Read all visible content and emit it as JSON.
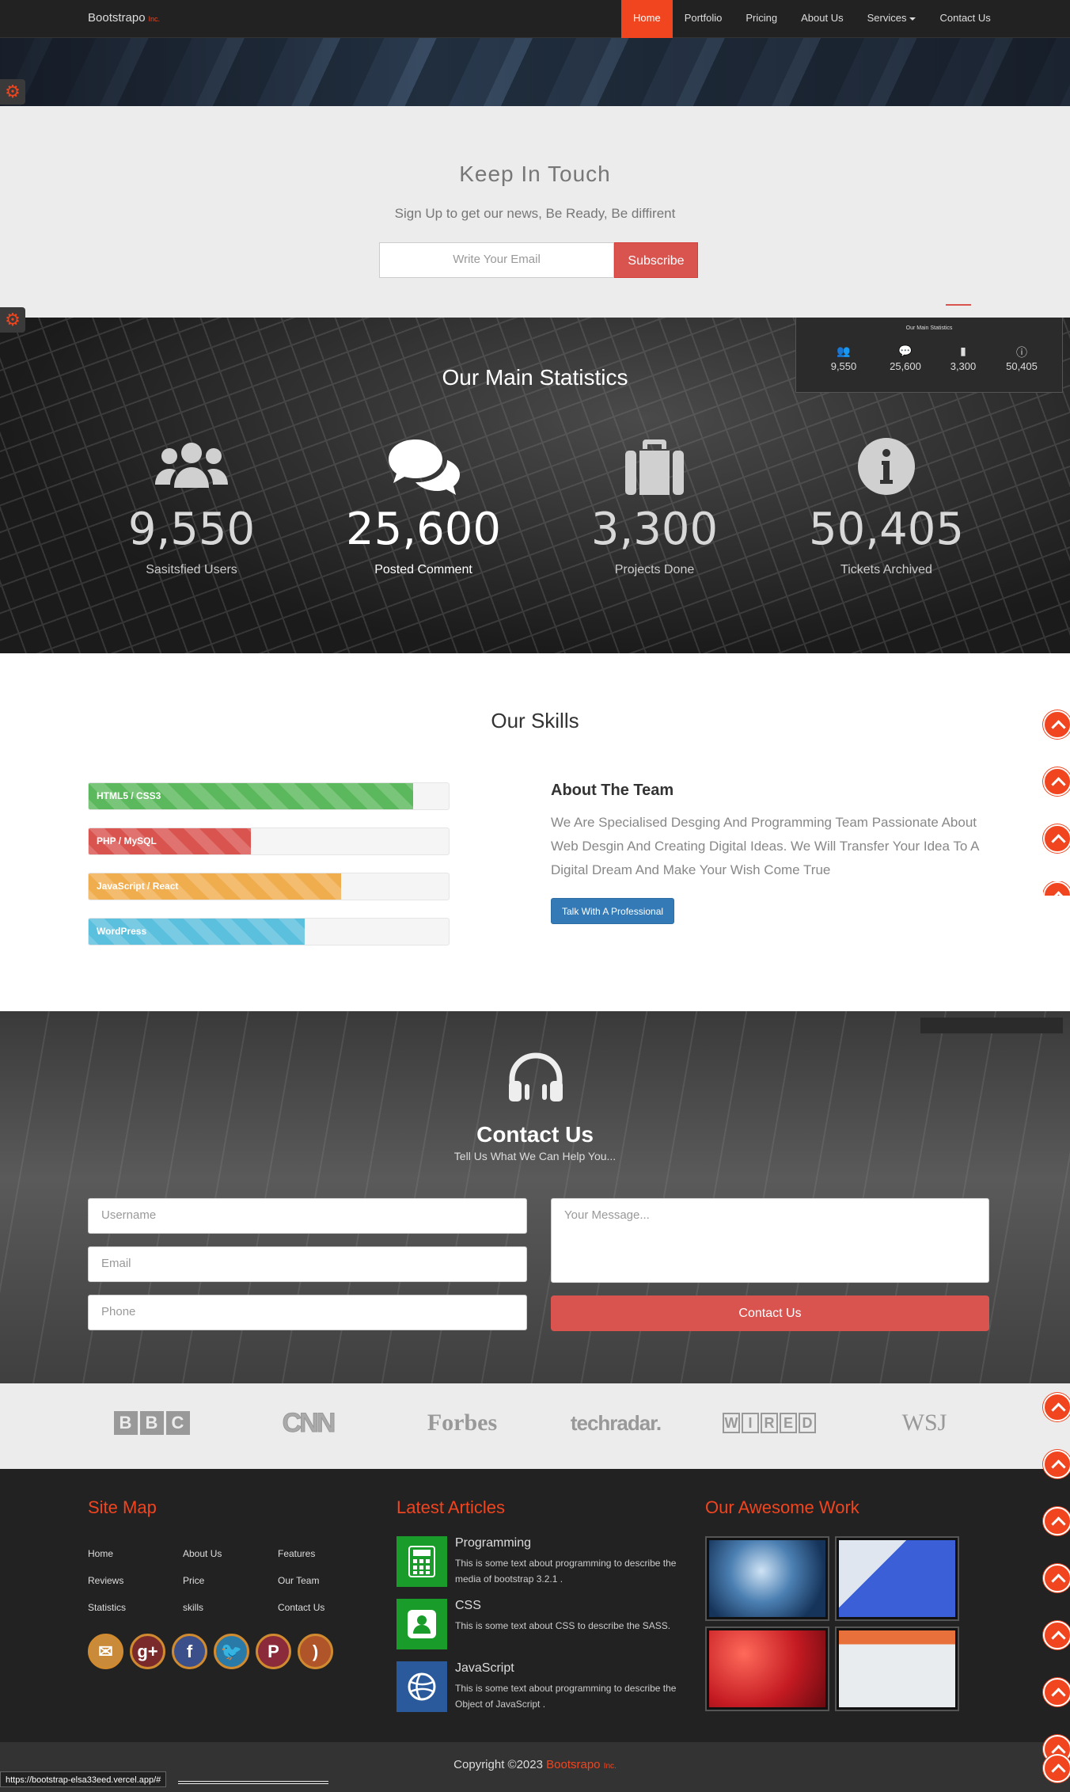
{
  "navbar": {
    "brand": "Bootstrapo",
    "brand_suffix": "Inc.",
    "items": [
      "Home",
      "Portfolio",
      "Pricing",
      "About Us",
      "Services",
      "Contact Us"
    ]
  },
  "subscribe": {
    "title": "Keep In Touch",
    "subtitle": "Sign Up to get our news, Be Ready, Be diffirent",
    "placeholder": "Write Your Email",
    "button": "Subscribe"
  },
  "stats": {
    "title": "Our Main Statistics",
    "items": [
      {
        "value": "9,550",
        "label": "Sasitsfied Users",
        "icon": "users-icon"
      },
      {
        "value": "25,600",
        "label": "Posted Comment",
        "icon": "comments-icon"
      },
      {
        "value": "3,300",
        "label": "Projects Done",
        "icon": "briefcase-icon"
      },
      {
        "value": "50,405",
        "label": "Tickets Archived",
        "icon": "info-icon"
      }
    ]
  },
  "skills": {
    "title": "Our Skills",
    "bars": [
      {
        "label": "HTML5 / CSS3",
        "percent": 90,
        "color": "#5cb85c"
      },
      {
        "label": "PHP / MySQL",
        "percent": 45,
        "color": "#d9534f"
      },
      {
        "label": "JavaScript / React",
        "percent": 70,
        "color": "#f0ad4e"
      },
      {
        "label": "WordPress",
        "percent": 60,
        "color": "#5bc0de"
      }
    ],
    "team_title": "About The Team",
    "team_text": "We Are Specialised Desging And Programming Team Passionate About Web Desgin And Creating Digital Ideas. We Will Transfer Your Idea To A Digital Dream And Make Your Wish Come True",
    "team_button": "Talk With A Professional"
  },
  "contact": {
    "title": "Contact Us",
    "subtitle": "Tell Us What We Can Help You...",
    "username_placeholder": "Username",
    "email_placeholder": "Email",
    "phone_placeholder": "Phone",
    "message_placeholder": "Your Message...",
    "button": "Contact Us"
  },
  "logos": {
    "bbc": [
      "B",
      "B",
      "C"
    ],
    "cnn": "CNN",
    "forbes": "Forbes",
    "techradar": "techradar.",
    "wired": [
      "W",
      "I",
      "R",
      "E",
      "D"
    ],
    "wsj": "WSJ"
  },
  "footer": {
    "sitemap_title": "Site Map",
    "sitemap": [
      "Home",
      "About Us",
      "Features",
      "Reviews",
      "Price",
      "Our Team",
      "Statistics",
      "skills",
      "Contact Us"
    ],
    "articles_title": "Latest Articles",
    "articles": [
      {
        "title": "Programming",
        "text": "This is some text about programming to describe the media of bootstrap 3.2.1 .",
        "color": "#1a9c2a"
      },
      {
        "title": "CSS",
        "text": "This is some text about CSS to describe the SASS.",
        "color": "#1a9c2a"
      },
      {
        "title": "JavaScript",
        "text": "This is some text about programming to describe the Object of JavaScript .",
        "color": "#2a5a9c"
      }
    ],
    "work_title": "Our Awesome Work",
    "copyright": "Copyright ©2023",
    "copyright_brand": "Bootsrapo",
    "copyright_suffix": "Inc."
  },
  "status_url": "https://bootstrap-elsa33eed.vercel.app/#",
  "colors": {
    "accent": "#f0451f",
    "danger": "#d9534f",
    "primary": "#337ab7"
  }
}
